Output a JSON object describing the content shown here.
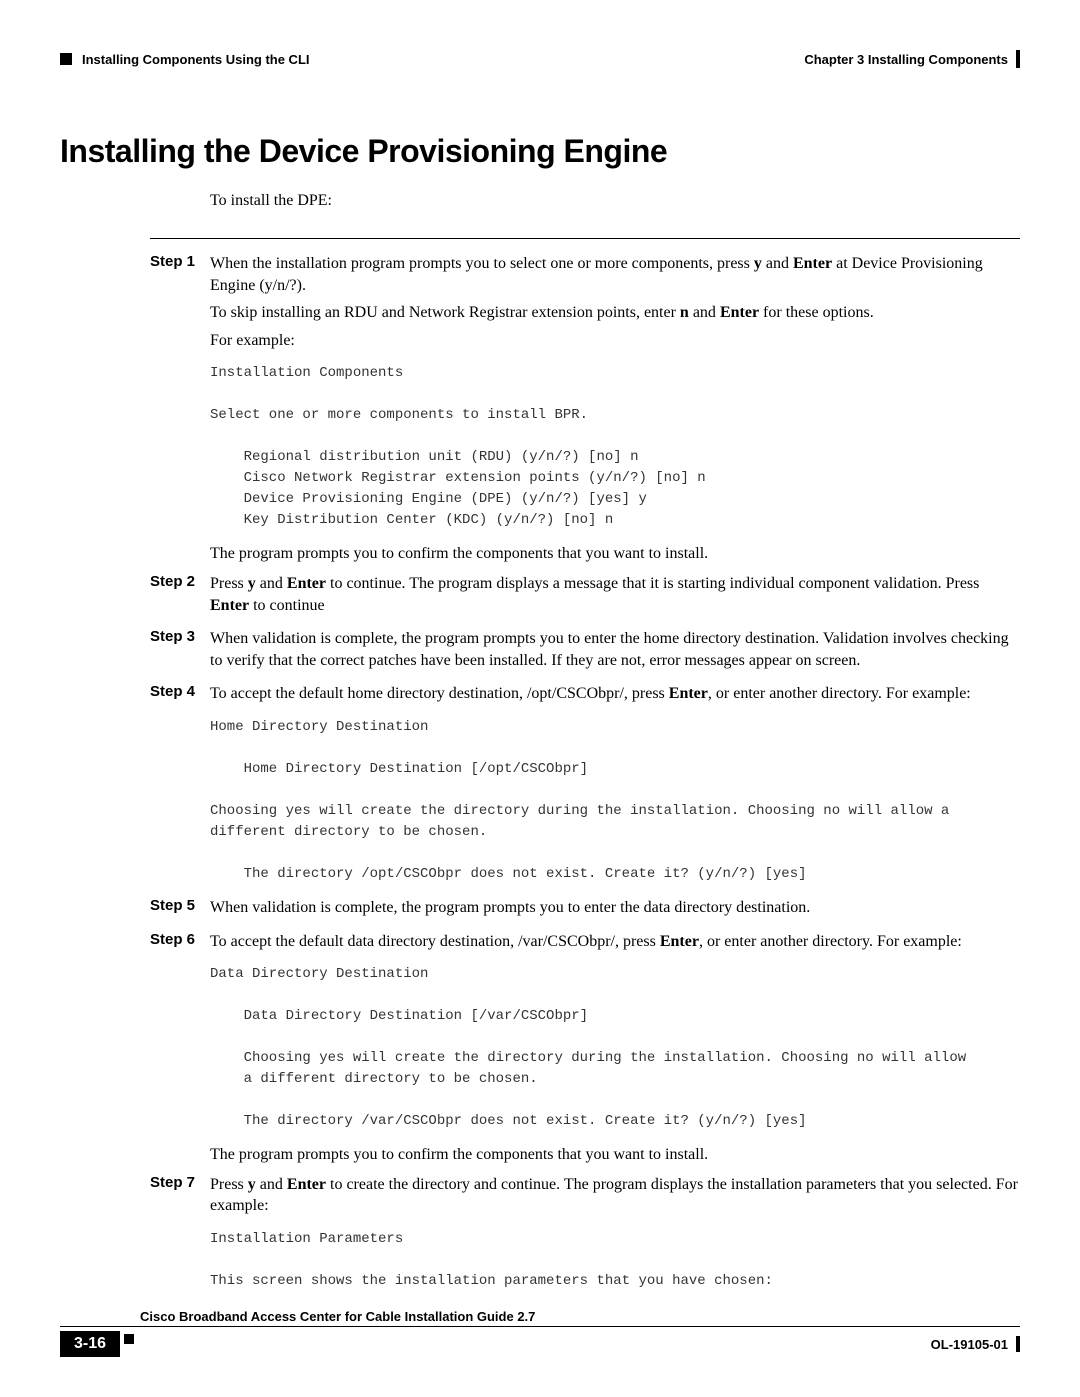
{
  "header": {
    "left_section": "Installing Components Using the CLI",
    "right_chapter": "Chapter 3      Installing Components"
  },
  "h1": "Installing the Device Provisioning Engine",
  "intro": "To install the DPE:",
  "steps": {
    "s1": {
      "label": "Step 1",
      "p1a": "When the installation program prompts you to select one or more components, press ",
      "p1b": "y",
      "p1c": " and ",
      "p1d": "Enter",
      "p1e": " at Device Provisioning Engine (y/n/?).",
      "p2a": "To skip installing an RDU and Network Registrar extension points, enter ",
      "p2b": "n",
      "p2c": " and ",
      "p2d": "Enter",
      "p2e": " for these options.",
      "p3": "For example:"
    },
    "code1": "Installation Components\n\nSelect one or more components to install BPR.\n\n    Regional distribution unit (RDU) (y/n/?) [no] n\n    Cisco Network Registrar extension points (y/n/?) [no] n\n    Device Provisioning Engine (DPE) (y/n/?) [yes] y\n    Key Distribution Center (KDC) (y/n/?) [no] n",
    "after1": "The program prompts you to confirm the components that you want to install.",
    "s2": {
      "label": "Step 2",
      "a": "Press ",
      "b": "y",
      "c": " and ",
      "d": "Enter",
      "e": " to continue. The program displays a message that it is starting individual component validation. Press ",
      "f": "Enter",
      "g": " to continue"
    },
    "s3": {
      "label": "Step 3",
      "text": "When validation is complete, the program prompts you to enter the home directory destination. Validation involves checking to verify that the correct patches have been installed. If they are not, error messages appear on screen."
    },
    "s4": {
      "label": "Step 4",
      "a": "To accept the default home directory destination, /opt/CSCObpr/, press ",
      "b": "Enter",
      "c": ", or enter another directory. For example:"
    },
    "code4": "Home Directory Destination\n\n    Home Directory Destination [/opt/CSCObpr]\n\nChoosing yes will create the directory during the installation. Choosing no will allow a \ndifferent directory to be chosen.\n\n    The directory /opt/CSCObpr does not exist. Create it? (y/n/?) [yes]",
    "s5": {
      "label": "Step 5",
      "text": "When validation is complete, the program prompts you to enter the data directory destination."
    },
    "s6": {
      "label": "Step 6",
      "a": "To accept the default data directory destination, /var/CSCObpr/, press ",
      "b": "Enter",
      "c": ", or enter another directory. For example:"
    },
    "code6": "Data Directory Destination\n\n    Data Directory Destination [/var/CSCObpr] \n\n    Choosing yes will create the directory during the installation. Choosing no will allow \n    a different directory to be chosen.\n\n    The directory /var/CSCObpr does not exist. Create it? (y/n/?) [yes]",
    "after6": "The program prompts you to confirm the components that you want to install.",
    "s7": {
      "label": "Step 7",
      "a": "Press ",
      "b": "y",
      "c": " and ",
      "d": "Enter",
      "e": " to create the directory and continue. The program displays the installation parameters that you selected. For example:"
    },
    "code7": "Installation Parameters\n\nThis screen shows the installation parameters that you have chosen:"
  },
  "footer": {
    "title": "Cisco Broadband Access Center for Cable Installation Guide 2.7",
    "page": "3-16",
    "docnum": "OL-19105-01"
  }
}
